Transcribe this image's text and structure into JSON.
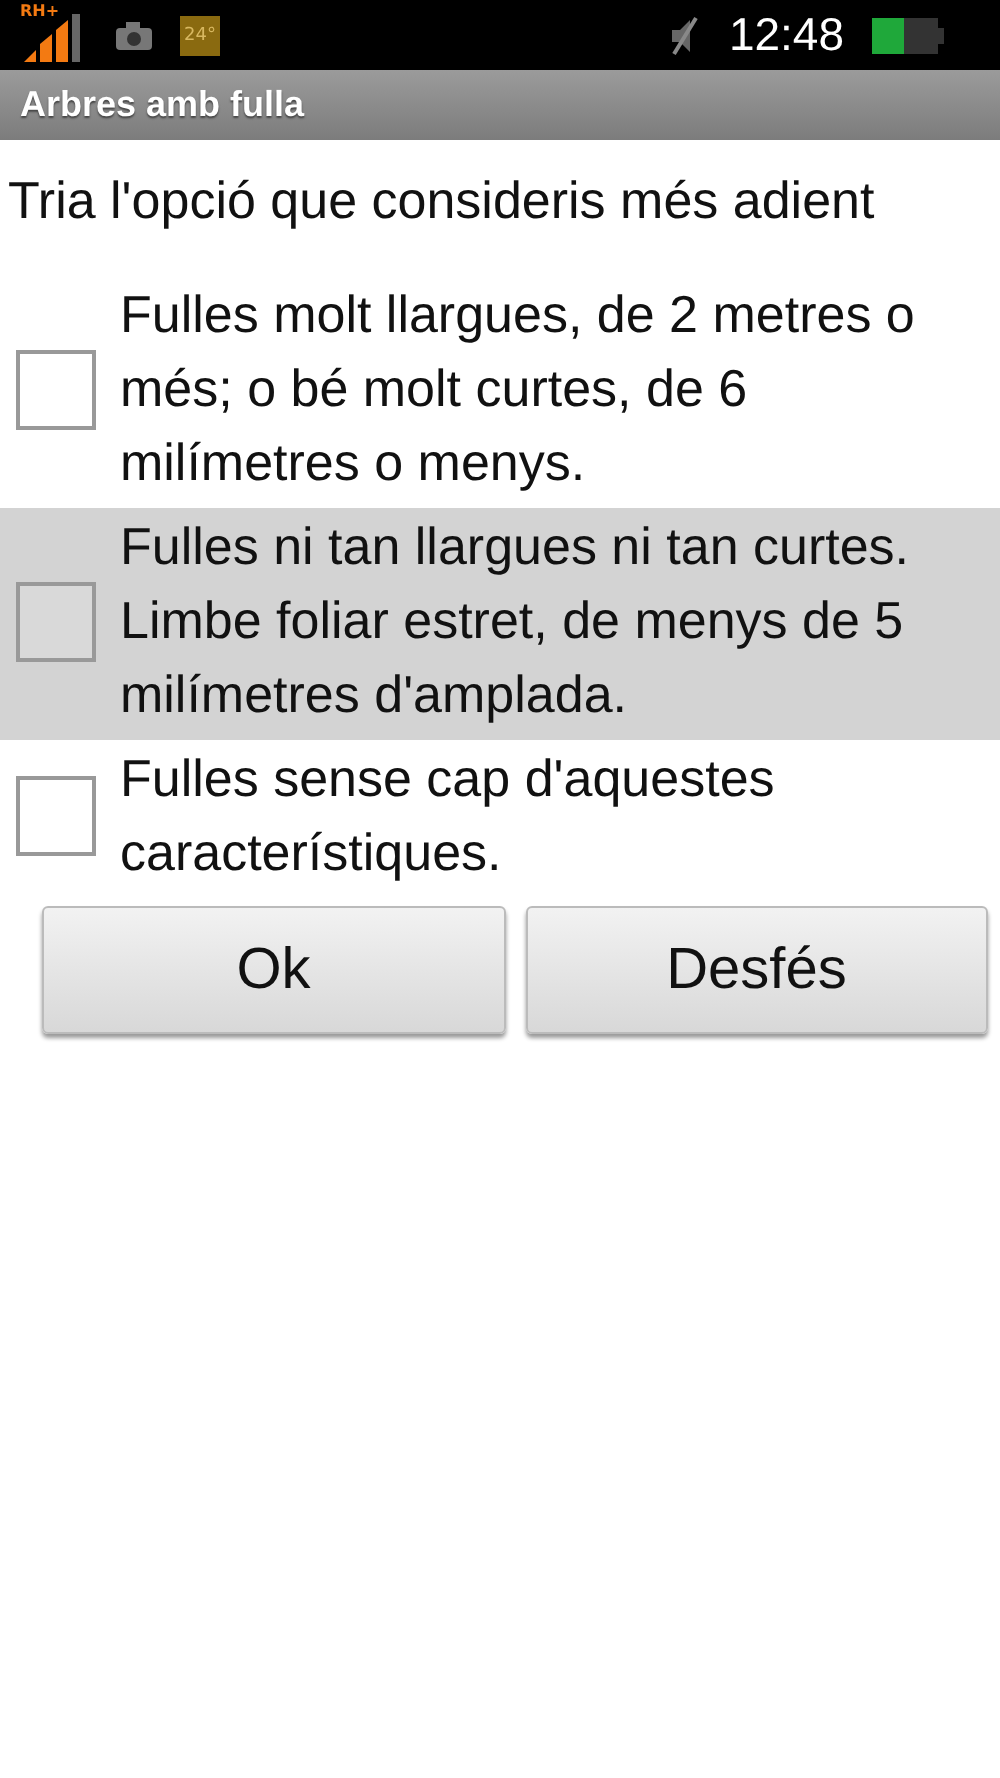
{
  "status_bar": {
    "network": "RH+",
    "temperature": "24°",
    "time": "12:48"
  },
  "title_bar": {
    "title": "Arbres amb fulla"
  },
  "question": "Tria l'opció que consideris més adient",
  "options": [
    {
      "label": "Fulles molt llargues, de 2 metres o més; o bé molt curtes, de 6 milímetres o menys.",
      "checked": false,
      "selected": false
    },
    {
      "label": "Fulles ni tan llargues ni tan curtes. Limbe foliar estret, de menys de 5 milímetres d'amplada.",
      "checked": false,
      "selected": true
    },
    {
      "label": "Fulles sense cap d'aquestes característiques.",
      "checked": false,
      "selected": false
    }
  ],
  "buttons": [
    "Ok",
    "Desfés"
  ]
}
